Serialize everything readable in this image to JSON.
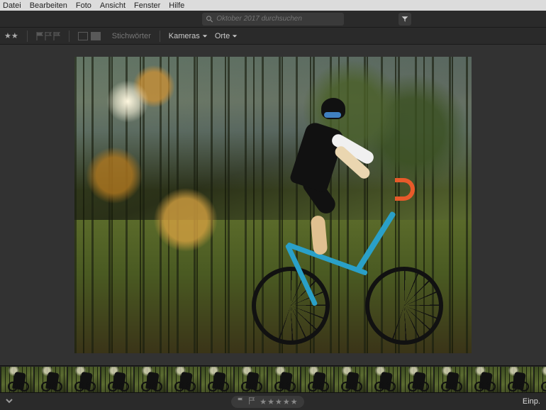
{
  "menu": {
    "items": [
      "Datei",
      "Bearbeiten",
      "Foto",
      "Ansicht",
      "Fenster",
      "Hilfe"
    ]
  },
  "search": {
    "placeholder": "Oktober 2017 durchsuchen"
  },
  "toolbar": {
    "keywords_label": "Stichwörter",
    "cameras_label": "Kameras",
    "places_label": "Orte"
  },
  "bottombar": {
    "fit_label": "Einp."
  },
  "thumb_count": 17
}
